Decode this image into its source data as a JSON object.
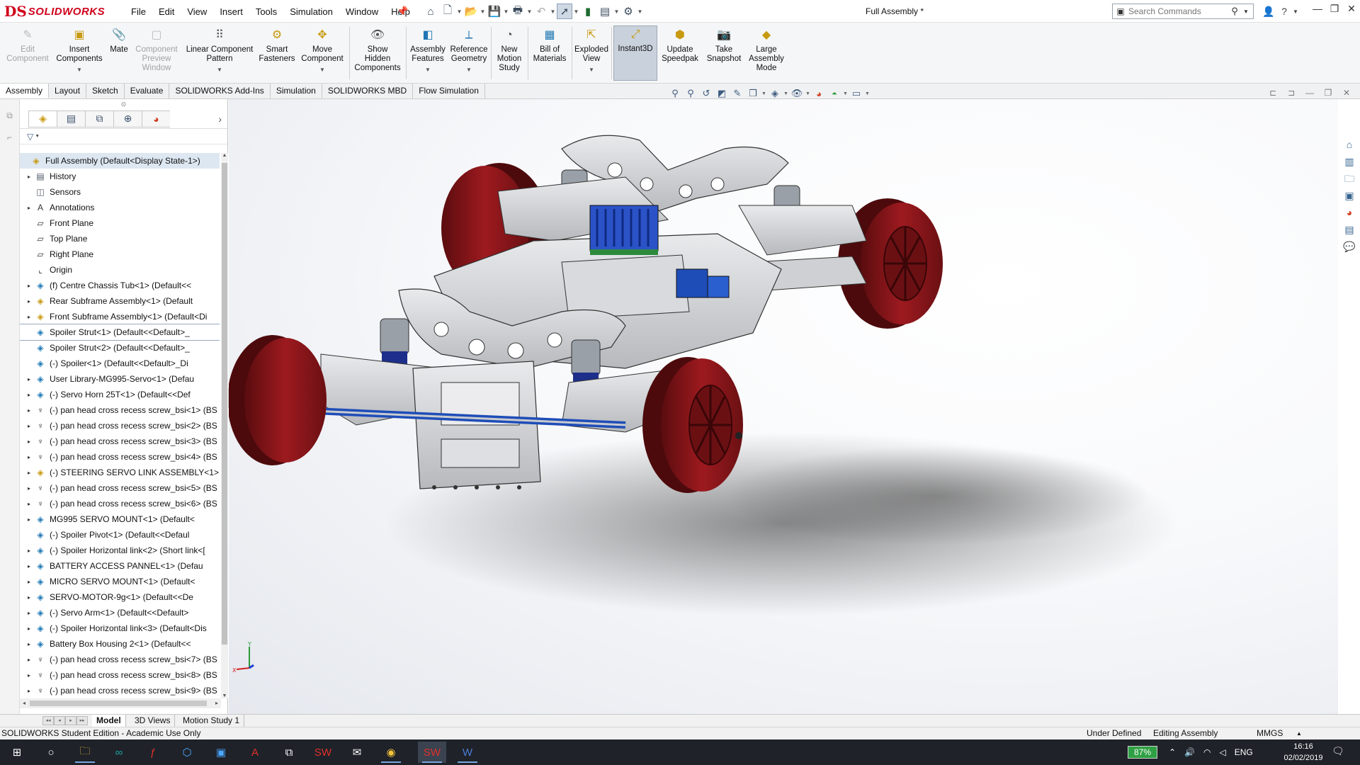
{
  "app": {
    "logo_ds": "DS",
    "logo_text": "SOLIDWORKS",
    "document_title": "Full Assembly *"
  },
  "menu": [
    "File",
    "Edit",
    "View",
    "Insert",
    "Tools",
    "Simulation",
    "Window",
    "Help"
  ],
  "quick_access_icons": [
    "home-icon",
    "new-document-icon",
    "open-icon",
    "save-icon",
    "print-icon",
    "undo-icon",
    "select-icon",
    "rebuild-icon",
    "file-properties-icon",
    "options-icon"
  ],
  "search": {
    "placeholder": "Search Commands"
  },
  "ribbon": {
    "buttons": [
      {
        "label": "Edit\nComponent",
        "icon": "edit-component-icon",
        "disabled": true
      },
      {
        "label": "Insert\nComponents",
        "icon": "insert-components-icon",
        "disabled": false,
        "dropdown": true
      },
      {
        "label": "Mate",
        "icon": "mate-icon",
        "disabled": false
      },
      {
        "label": "Component\nPreview\nWindow",
        "icon": "component-preview-icon",
        "disabled": true
      },
      {
        "label": "Linear Component\nPattern",
        "icon": "linear-pattern-icon",
        "disabled": false,
        "dropdown": true
      },
      {
        "label": "Smart\nFasteners",
        "icon": "smart-fasteners-icon",
        "disabled": false
      },
      {
        "label": "Move\nComponent",
        "icon": "move-component-icon",
        "disabled": false,
        "dropdown": true
      },
      {
        "label": "Show\nHidden\nComponents",
        "icon": "show-hidden-icon",
        "disabled": false
      },
      {
        "label": "Assembly\nFeatures",
        "icon": "assembly-features-icon",
        "disabled": false,
        "dropdown": true
      },
      {
        "label": "Reference\nGeometry",
        "icon": "reference-geometry-icon",
        "disabled": false,
        "dropdown": true
      },
      {
        "label": "New\nMotion\nStudy",
        "icon": "motion-study-icon",
        "disabled": false
      },
      {
        "label": "Bill of\nMaterials",
        "icon": "bill-of-materials-icon",
        "disabled": false
      },
      {
        "label": "Exploded\nView",
        "icon": "exploded-view-icon",
        "disabled": false,
        "dropdown": true
      },
      {
        "label": "Instant3D",
        "icon": "instant3d-icon",
        "disabled": false,
        "active": true
      },
      {
        "label": "Update\nSpeedpak",
        "icon": "speedpak-icon",
        "disabled": false
      },
      {
        "label": "Take\nSnapshot",
        "icon": "snapshot-icon",
        "disabled": false
      },
      {
        "label": "Large\nAssembly\nMode",
        "icon": "large-assembly-icon",
        "disabled": false
      }
    ]
  },
  "command_tabs": [
    "Assembly",
    "Layout",
    "Sketch",
    "Evaluate",
    "SOLIDWORKS Add-Ins",
    "Simulation",
    "SOLIDWORKS MBD",
    "Flow Simulation"
  ],
  "feature_manager": {
    "tabs": [
      "feature-manager-tab-icon",
      "property-manager-tab-icon",
      "configuration-manager-tab-icon",
      "dimxpert-tab-icon",
      "display-manager-tab-icon"
    ],
    "tree": [
      {
        "label": "Full Assembly  (Default<Display State-1>)",
        "icon": "assembly-icon",
        "expand": "down",
        "level": 0
      },
      {
        "label": "History",
        "icon": "history-icon",
        "expand": "right",
        "level": 1
      },
      {
        "label": "Sensors",
        "icon": "sensors-icon",
        "expand": "",
        "level": 1
      },
      {
        "label": "Annotations",
        "icon": "annotations-icon",
        "expand": "right",
        "level": 1
      },
      {
        "label": "Front Plane",
        "icon": "plane-icon",
        "expand": "",
        "level": 1
      },
      {
        "label": "Top Plane",
        "icon": "plane-icon",
        "expand": "",
        "level": 1
      },
      {
        "label": "Right Plane",
        "icon": "plane-icon",
        "expand": "",
        "level": 1
      },
      {
        "label": "Origin",
        "icon": "origin-icon",
        "expand": "",
        "level": 1
      },
      {
        "label": "(f) Centre Chassis Tub<1> (Default<<",
        "icon": "part-icon",
        "expand": "right",
        "level": 1
      },
      {
        "label": "Rear Subframe Assembly<1> (Default",
        "icon": "subassembly-icon",
        "expand": "right",
        "level": 1
      },
      {
        "label": "Front Subframe Assembly<1> (Default<Di",
        "icon": "subassembly-icon",
        "expand": "right",
        "level": 1
      },
      {
        "label": "Spoiler Strut<1> (Default<<Default>_",
        "icon": "part-icon",
        "expand": "",
        "level": 1
      },
      {
        "label": "Spoiler Strut<2> (Default<<Default>_",
        "icon": "part-icon",
        "expand": "",
        "level": 1
      },
      {
        "label": "(-) Spoiler<1> (Default<<Default>_Di",
        "icon": "part-icon",
        "expand": "",
        "level": 1
      },
      {
        "label": "User Library-MG995-Servo<1> (Defau",
        "icon": "part-icon",
        "expand": "right",
        "level": 1
      },
      {
        "label": "(-) Servo Horn 25T<1> (Default<<Def",
        "icon": "part-icon",
        "expand": "right",
        "level": 1
      },
      {
        "label": "(-) pan head cross recess screw_bsi<1> (BS",
        "icon": "screw-icon",
        "expand": "right",
        "level": 1
      },
      {
        "label": "(-) pan head cross recess screw_bsi<2> (BS",
        "icon": "screw-icon",
        "expand": "right",
        "level": 1
      },
      {
        "label": "(-) pan head cross recess screw_bsi<3> (BS",
        "icon": "screw-icon",
        "expand": "right",
        "level": 1
      },
      {
        "label": "(-) pan head cross recess screw_bsi<4> (BS",
        "icon": "screw-icon",
        "expand": "right",
        "level": 1
      },
      {
        "label": "(-) STEERING SERVO LINK ASSEMBLY<1> (",
        "icon": "subassembly-icon",
        "expand": "right",
        "level": 1
      },
      {
        "label": "(-) pan head cross recess screw_bsi<5> (BS",
        "icon": "screw-icon",
        "expand": "right",
        "level": 1
      },
      {
        "label": "(-) pan head cross recess screw_bsi<6> (BS",
        "icon": "screw-icon",
        "expand": "right",
        "level": 1
      },
      {
        "label": "MG995 SERVO MOUNT<1> (Default<",
        "icon": "part-icon",
        "expand": "right",
        "level": 1
      },
      {
        "label": "(-) Spoiler Pivot<1> (Default<<Defaul",
        "icon": "part-icon",
        "expand": "",
        "level": 1
      },
      {
        "label": "(-) Spoiler Horizontal link<2> (Short link<[",
        "icon": "part-icon",
        "expand": "right",
        "level": 1
      },
      {
        "label": "BATTERY ACCESS PANNEL<1> (Defau",
        "icon": "part-icon",
        "expand": "right",
        "level": 1
      },
      {
        "label": "MICRO SERVO MOUNT<1> (Default<",
        "icon": "part-icon",
        "expand": "right",
        "level": 1
      },
      {
        "label": "SERVO-MOTOR-9g<1> (Default<<De",
        "icon": "part-icon",
        "expand": "right",
        "level": 1
      },
      {
        "label": "(-) Servo Arm<1> (Default<<Default>",
        "icon": "part-icon",
        "expand": "right",
        "level": 1
      },
      {
        "label": "(-) Spoiler Horizontal link<3> (Default<Dis",
        "icon": "part-icon",
        "expand": "right",
        "level": 1
      },
      {
        "label": "Battery Box Housing 2<1> (Default<<",
        "icon": "part-icon",
        "expand": "right",
        "level": 1
      },
      {
        "label": "(-) pan head cross recess screw_bsi<7> (BS",
        "icon": "screw-icon",
        "expand": "right",
        "level": 1
      },
      {
        "label": "(-) pan head cross recess screw_bsi<8> (BS",
        "icon": "screw-icon",
        "expand": "right",
        "level": 1
      },
      {
        "label": "(-) pan head cross recess screw_bsi<9> (BS",
        "icon": "screw-icon",
        "expand": "right",
        "level": 1
      }
    ]
  },
  "viewport": {
    "model_description_icon": "rc-car-chassis-3d-model",
    "colors": {
      "wheel": "#8b1418",
      "frame": "#d8d9dc",
      "servo_blue": "#1f4db8",
      "spring_blue": "#1d2f8a"
    },
    "triad": {
      "x": "X",
      "y": "Y"
    }
  },
  "bottom_tabs": [
    "Model",
    "3D Views",
    "Motion Study 1"
  ],
  "status": {
    "edition": "SOLIDWORKS Student Edition - Academic Use Only",
    "definition": "Under Defined",
    "mode": "Editing Assembly",
    "units": "MMGS"
  },
  "taskbar": {
    "icons": [
      "windows-start-icon",
      "search-circle-icon",
      "file-explorer-icon",
      "arduino-icon",
      "flash-icon",
      "box-icon",
      "store-icon",
      "acrobat-icon",
      "solidworks-launcher-icon",
      "solidworks-2018-icon",
      "mail-icon",
      "chrome-icon",
      "solidworks-2018-active-icon",
      "word-icon"
    ],
    "battery": "87%",
    "language": "ENG",
    "time": "16:16",
    "date": "02/02/2019"
  }
}
